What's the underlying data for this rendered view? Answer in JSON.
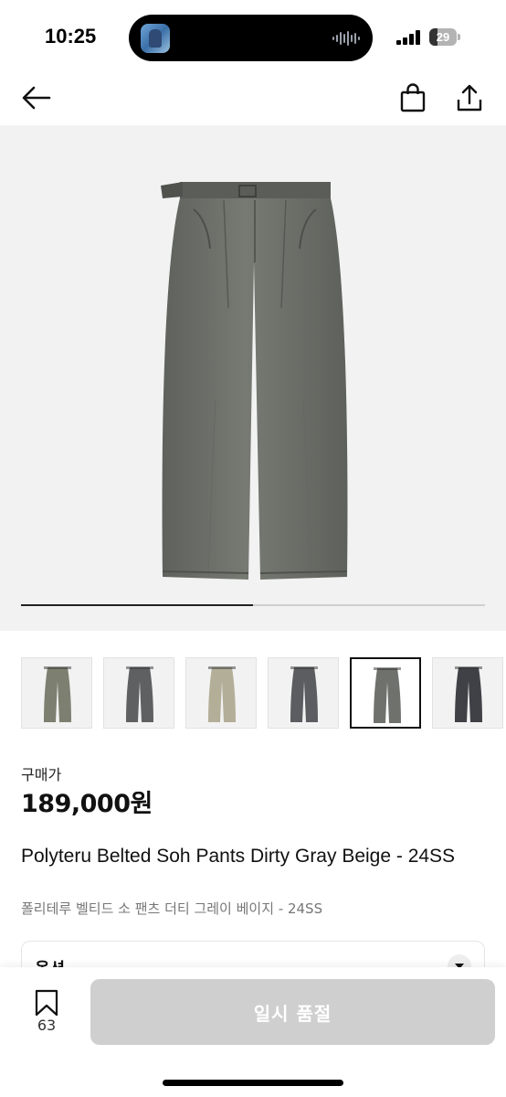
{
  "status_bar": {
    "time": "10:25",
    "battery": "29",
    "battery_level": 0.29
  },
  "nav": {
    "back_icon": "arrow-left-icon",
    "bag_icon": "shopping-bag-icon",
    "share_icon": "share-icon"
  },
  "gallery": {
    "progress": 0.5,
    "thumbnails": [
      {
        "color": "#7d8070"
      },
      {
        "color": "#5f6062"
      },
      {
        "color": "#b3ae98"
      },
      {
        "color": "#5c5d60"
      },
      {
        "color": "#6f726c"
      },
      {
        "color": "#3f4146"
      }
    ],
    "selected_index": 4
  },
  "price": {
    "label": "구매가",
    "value": "189,000원"
  },
  "product": {
    "title_en": "Polyteru Belted Soh Pants Dirty Gray Beige - 24SS",
    "title_ko": "폴리테루 벨티드 소 팬츠 더티 그레이 베이지 - 24SS"
  },
  "option": {
    "label": "옵션"
  },
  "bottom_bar": {
    "bookmark_count": "63",
    "cta_label": "일시 품절"
  },
  "colors": {
    "cta_disabled": "#cfcfcf",
    "pants_main": "#6e716b"
  }
}
